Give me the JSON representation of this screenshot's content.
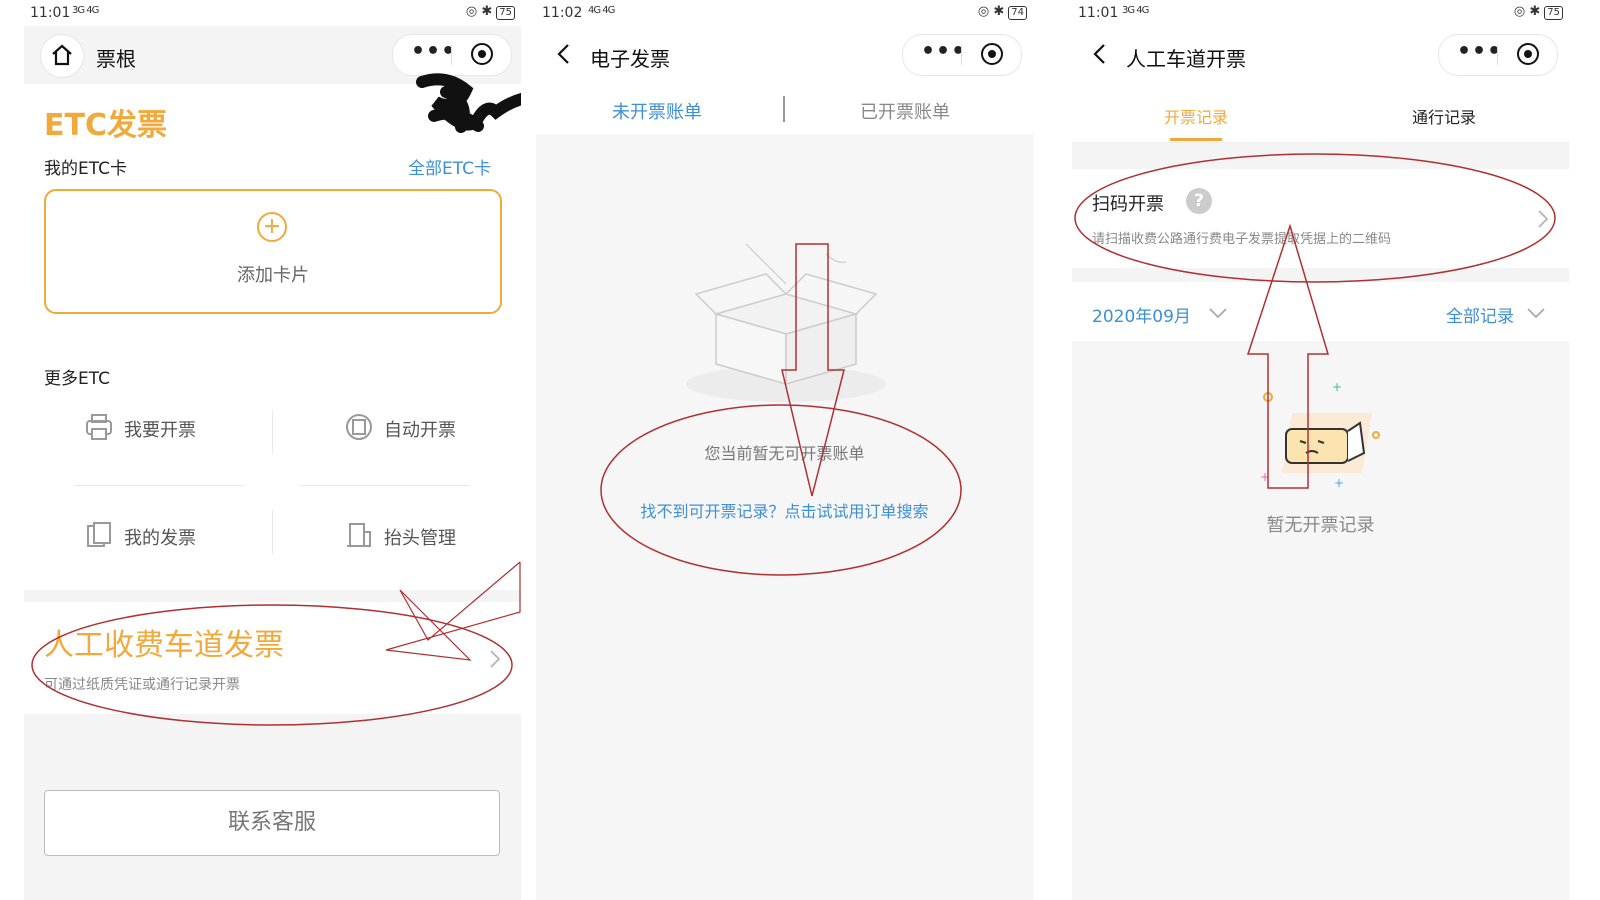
{
  "colors": {
    "accent_orange": "#f2a93b",
    "link_blue": "#3d8fd6",
    "annotation_red": "#b03030"
  },
  "status": {
    "p1": {
      "time": "11:01",
      "net": "3G 4G",
      "battery": "75"
    },
    "p2": {
      "time": "11:02",
      "net": "4G 4G",
      "battery": "74"
    },
    "p3": {
      "time": "11:01",
      "net": "3G 4G",
      "battery": "75"
    }
  },
  "panel1": {
    "nav_title": "票根",
    "etc_title": "ETC发票",
    "my_etc_label": "我的ETC卡",
    "all_etc_link": "全部ETC卡",
    "add_card": "添加卡片",
    "more_etc_label": "更多ETC",
    "grid": [
      {
        "label": "我要开票",
        "icon": "printer-icon"
      },
      {
        "label": "自动开票",
        "icon": "auto-invoice-icon"
      },
      {
        "label": "我的发票",
        "icon": "invoice-icon"
      },
      {
        "label": "抬头管理",
        "icon": "building-icon"
      }
    ],
    "manual_title": "人工收费车道发票",
    "manual_sub": "可通过纸质凭证或通行记录开票",
    "contact": "联系客服"
  },
  "panel2": {
    "nav_title": "电子发票",
    "tabs": [
      "未开票账单",
      "已开票账单"
    ],
    "empty_text": "您当前暂无可开票账单",
    "search_link": "找不到可开票记录？点击试试用订单搜索"
  },
  "panel3": {
    "nav_title": "人工车道开票",
    "tabs": [
      "开票记录",
      "通行记录"
    ],
    "scan_title": "扫码开票",
    "scan_help": "?",
    "scan_sub": "请扫描收费公路通行费电子发票提取凭据上的二维码",
    "month": "2020年09月",
    "filter": "全部记录",
    "empty_text": "暂无开票记录"
  }
}
